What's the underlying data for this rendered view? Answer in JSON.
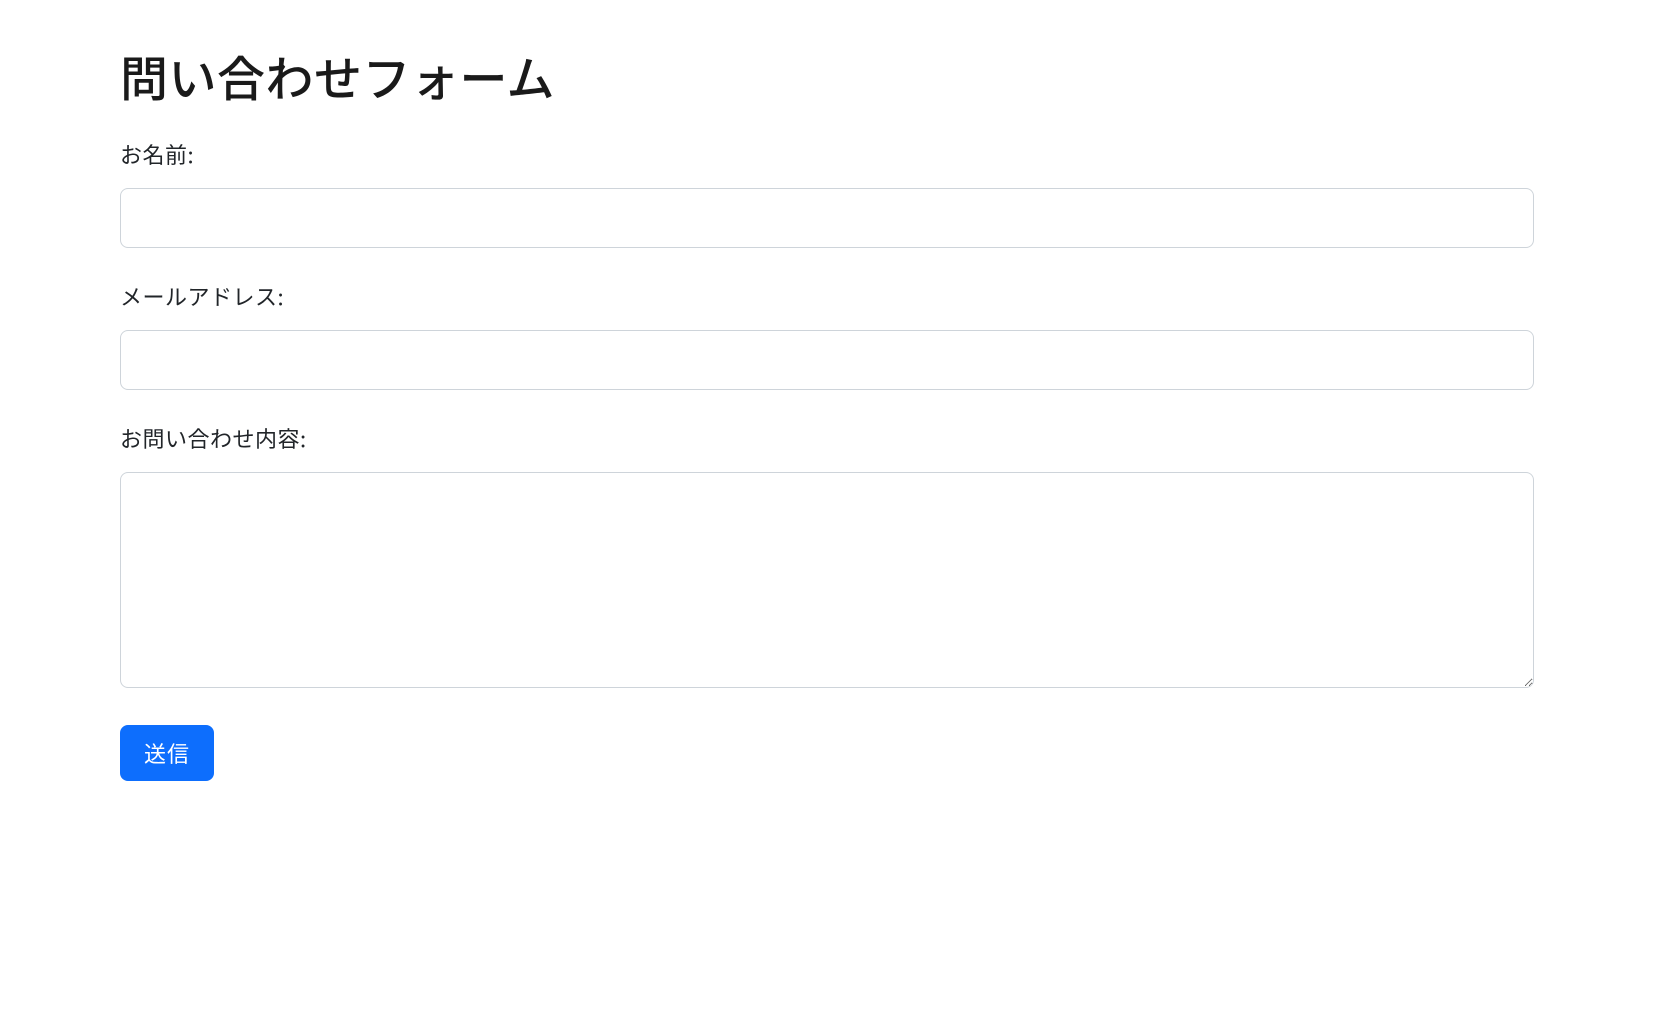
{
  "form": {
    "title": "問い合わせフォーム",
    "fields": {
      "name": {
        "label": "お名前:",
        "value": ""
      },
      "email": {
        "label": "メールアドレス:",
        "value": ""
      },
      "message": {
        "label": "お問い合わせ内容:",
        "value": ""
      }
    },
    "submit_label": "送信"
  },
  "colors": {
    "primary": "#0d6efd",
    "text": "#212529",
    "border": "#ced4da"
  }
}
